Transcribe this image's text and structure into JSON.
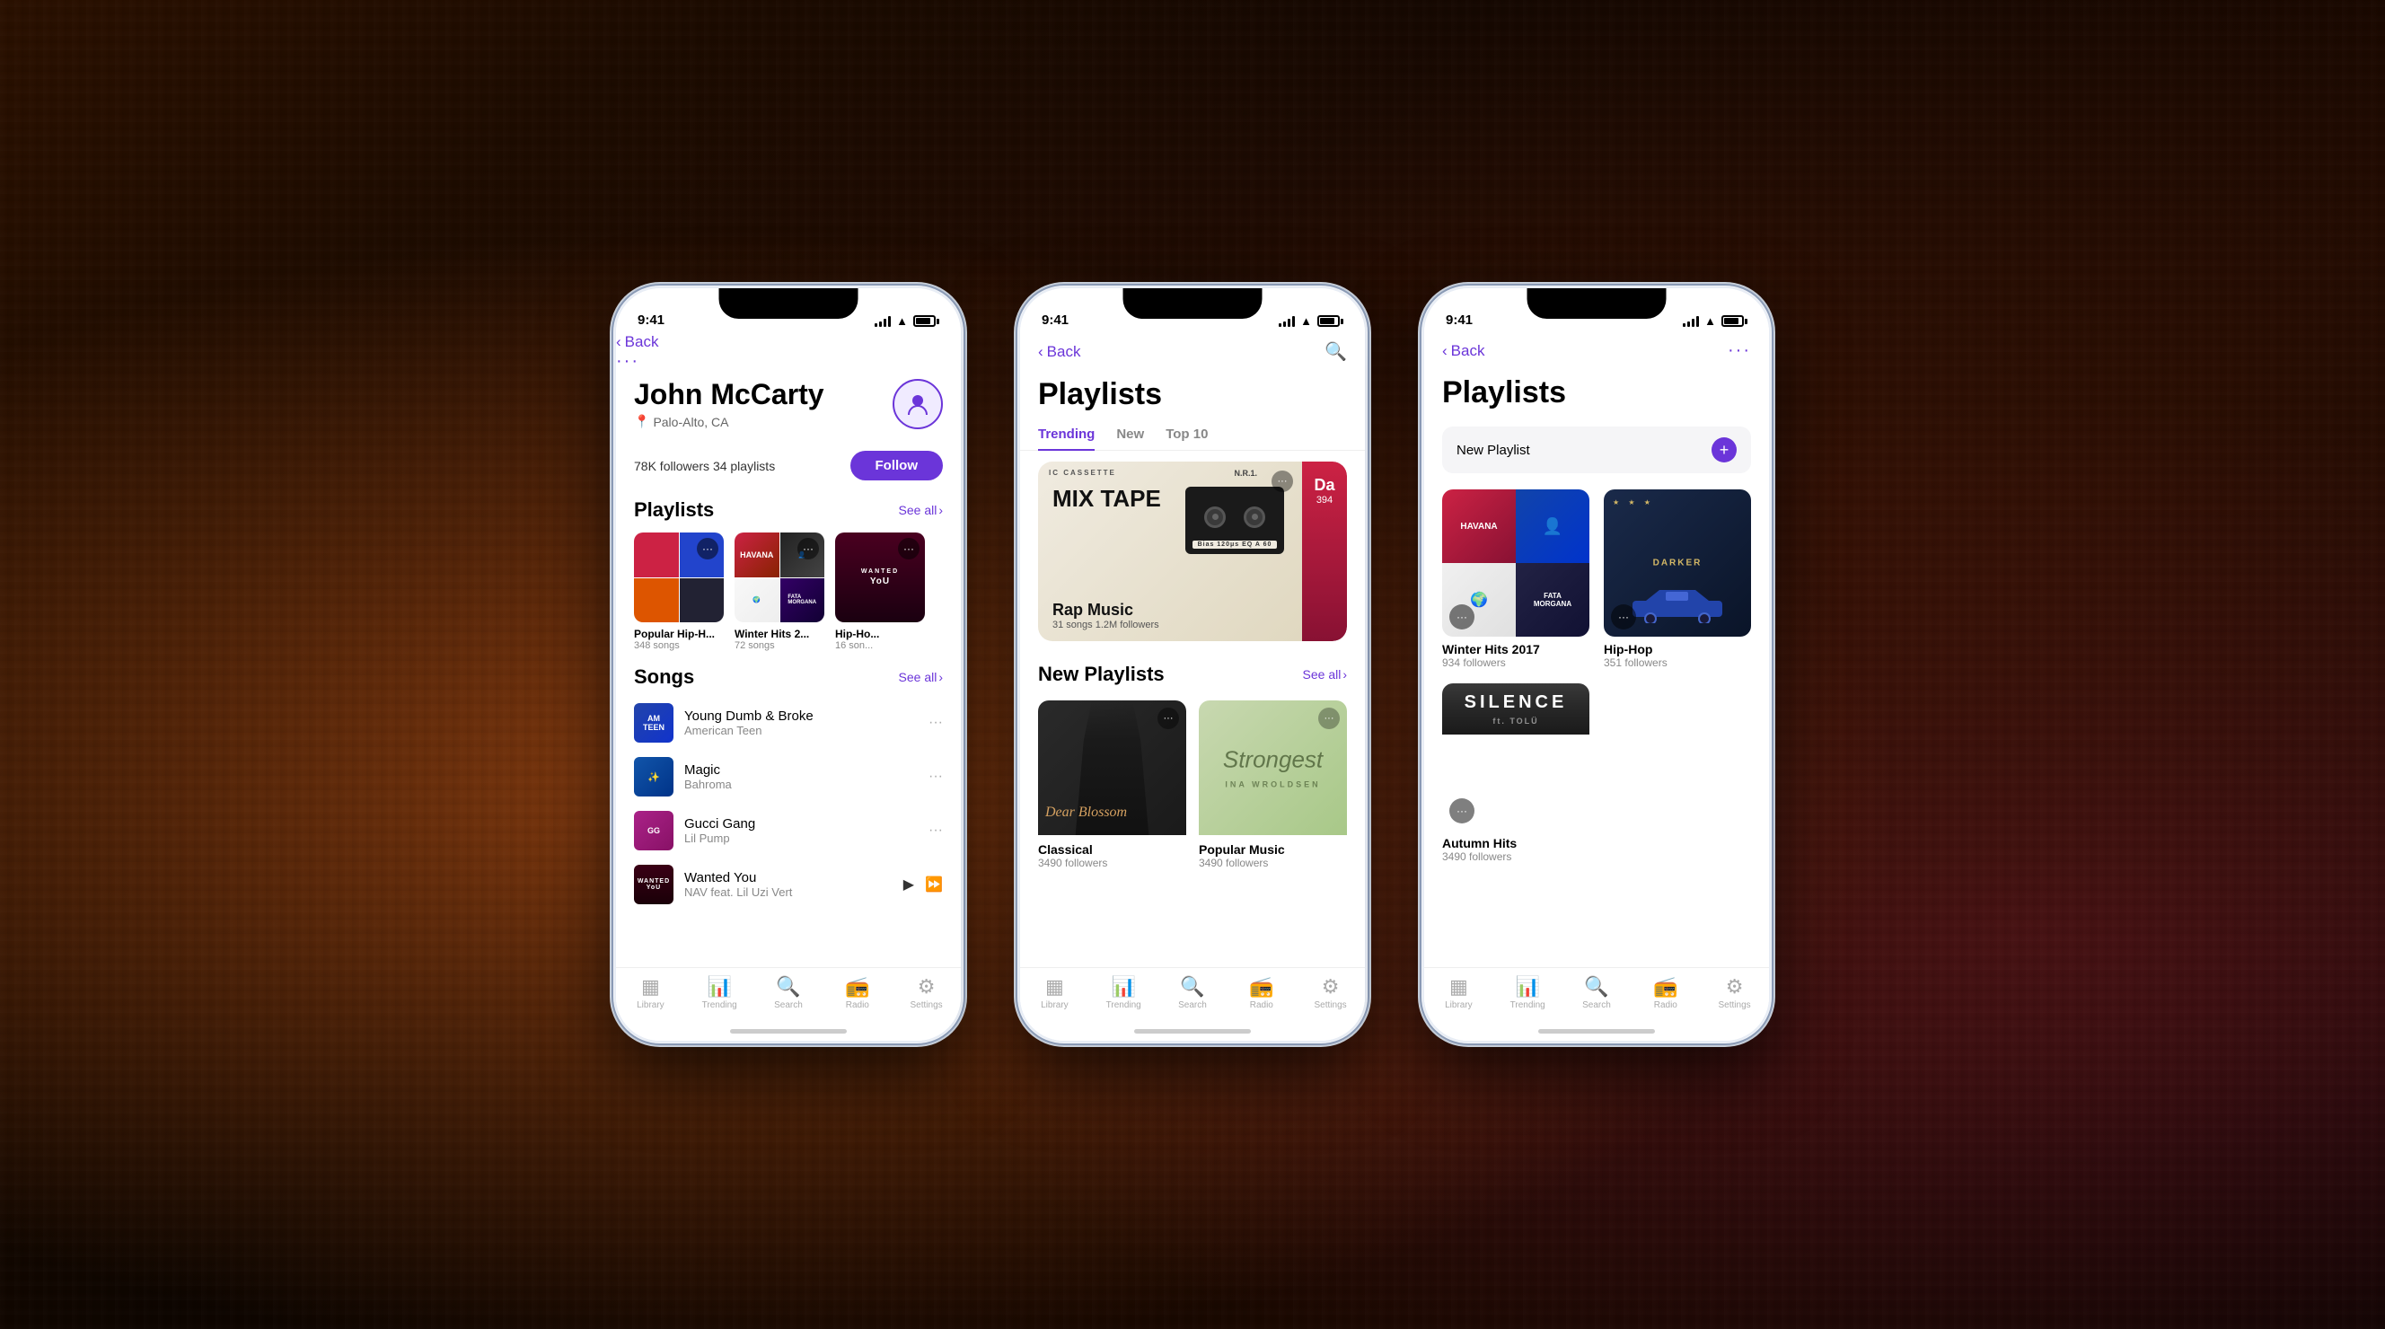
{
  "background": {
    "description": "Music mixing board keyboard background with warm amber tones"
  },
  "phone1": {
    "status": {
      "time": "9:41",
      "signal": true,
      "wifi": true,
      "battery": true
    },
    "nav": {
      "back_label": "Back",
      "more_label": "···"
    },
    "profile": {
      "name": "John McCarty",
      "location": "Palo-Alto, CA",
      "followers": "78K followers",
      "playlists_count": "34 playlists",
      "follow_button": "Follow"
    },
    "playlists_section": {
      "title": "Playlists",
      "see_all": "See all",
      "items": [
        {
          "name": "Popular Hip-H...",
          "count": "348 songs"
        },
        {
          "name": "Winter Hits 2...",
          "count": "72 songs"
        },
        {
          "name": "Hip-Ho...",
          "count": "16 son..."
        }
      ]
    },
    "songs_section": {
      "title": "Songs",
      "see_all": "See all",
      "items": [
        {
          "title": "Young Dumb & Broke",
          "artist": "American Teen",
          "playing": false
        },
        {
          "title": "Magic",
          "artist": "Bahroma",
          "playing": false
        },
        {
          "title": "Gucci Gang",
          "artist": "Lil Pump",
          "playing": false
        },
        {
          "title": "Wanted You",
          "artist": "NAV feat. Lil Uzi Vert",
          "playing": true
        }
      ]
    },
    "tabs": [
      {
        "label": "Library",
        "icon": "library",
        "active": false
      },
      {
        "label": "Trending",
        "icon": "trending",
        "active": false
      },
      {
        "label": "Search",
        "icon": "search",
        "active": false
      },
      {
        "label": "Radio",
        "icon": "radio",
        "active": false
      },
      {
        "label": "Settings",
        "icon": "settings",
        "active": false
      }
    ]
  },
  "phone2": {
    "status": {
      "time": "9:41"
    },
    "nav": {
      "back_label": "Back",
      "search_icon": "search"
    },
    "header": {
      "title": "Playlists"
    },
    "tabs": [
      {
        "label": "Trending",
        "active": true
      },
      {
        "label": "New",
        "active": false
      },
      {
        "label": "Top 10",
        "active": false
      }
    ],
    "featured": {
      "cassette_label": "IC CASSETTE",
      "nr_label": "N.R.1.",
      "mix_tape_title": "MIX TAPE",
      "playlist_name": "Rap Music",
      "songs_count": "31 songs",
      "followers": "1.2M followers",
      "side_label": "Da",
      "side_num": "394"
    },
    "new_playlists": {
      "title": "New Playlists",
      "see_all": "See all",
      "items": [
        {
          "name": "Classical",
          "followers": "3490 followers",
          "type": "classical"
        },
        {
          "name": "Popular Music",
          "followers": "3490 followers",
          "type": "popular"
        }
      ]
    },
    "bottom_tabs": [
      {
        "label": "Library",
        "icon": "library",
        "active": false
      },
      {
        "label": "Trending",
        "icon": "trending",
        "active": false
      },
      {
        "label": "Search",
        "icon": "search",
        "active": false
      },
      {
        "label": "Radio",
        "icon": "radio",
        "active": false
      },
      {
        "label": "Settings",
        "icon": "settings",
        "active": false
      }
    ]
  },
  "phone3": {
    "status": {
      "time": "9:41"
    },
    "nav": {
      "back_label": "Back",
      "more_label": "···"
    },
    "header": {
      "title": "Playlists"
    },
    "new_playlist_bar": {
      "label": "New Playlist",
      "add_icon": "+"
    },
    "playlists": [
      {
        "name": "Winter Hits 2017",
        "followers": "934 followers",
        "type": "winter"
      },
      {
        "name": "Hip-Hop",
        "followers": "351 followers",
        "type": "hiphop"
      },
      {
        "name": "Autumn Hits",
        "followers": "3490 followers",
        "type": "autumn"
      }
    ],
    "bottom_tabs": [
      {
        "label": "Library",
        "icon": "library",
        "active": false
      },
      {
        "label": "Trending",
        "icon": "trending",
        "active": false
      },
      {
        "label": "Search",
        "icon": "search",
        "active": false
      },
      {
        "label": "Radio",
        "icon": "radio",
        "active": false
      },
      {
        "label": "Settings",
        "icon": "settings",
        "active": false
      }
    ]
  }
}
